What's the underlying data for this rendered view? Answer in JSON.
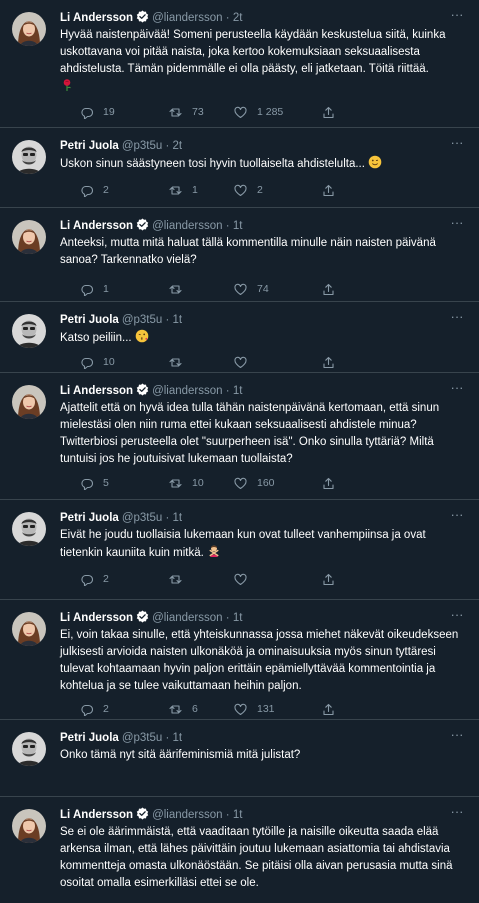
{
  "tweets": [
    {
      "author": "Li Andersson",
      "handle": "@liandersson",
      "sep": "·",
      "time": "2t",
      "verified": true,
      "avatar": "woman-avatar",
      "text": "Hyvää naistenpäivää! Someni perusteella käydään keskustelua siitä, kuinka uskottavana voi pitää naista, joka kertoo kokemuksiaan seksuaalisesta ahdistelusta. Tämän pidemmälle ei olla päästy, eli jatketaan. Töitä riittää.",
      "emoji": "rose-icon",
      "replies": "19",
      "retweets": "73",
      "likes": "1 285"
    },
    {
      "author": "Petri Juola",
      "handle": "@p3t5u",
      "sep": "·",
      "time": "2t",
      "verified": false,
      "avatar": "man-avatar",
      "text": "Uskon sinun säästyneen tosi hyvin tuollaiselta ahdistelulta...",
      "emoji": "wink-face-icon",
      "replies": "2",
      "retweets": "1",
      "likes": "2"
    },
    {
      "author": "Li Andersson",
      "handle": "@liandersson",
      "sep": "·",
      "time": "1t",
      "verified": true,
      "avatar": "woman-avatar",
      "text": "Anteeksi, mutta mitä haluat tällä kommentilla minulle näin naisten päivänä sanoa? Tarkennatko vielä?",
      "emoji": "",
      "replies": "1",
      "retweets": "",
      "likes": "74"
    },
    {
      "author": "Petri Juola",
      "handle": "@p3t5u",
      "sep": "·",
      "time": "1t",
      "verified": false,
      "avatar": "man-avatar",
      "text": "Katso peiliin...",
      "emoji": "kiss-face-icon",
      "replies": "10",
      "retweets": "",
      "likes": ""
    },
    {
      "author": "Li Andersson",
      "handle": "@liandersson",
      "sep": "·",
      "time": "1t",
      "verified": true,
      "avatar": "woman-avatar",
      "text": "Ajattelit että on hyvä idea tulla tähän naistenpäivänä kertomaan, että sinun mielestäsi olen niin ruma ettei kukaan seksuaalisesti ahdistele minua? Twitterbiosi perusteella olet \"suurperheen isä\". Onko sinulla tyttäriä? Miltä tuntuisi jos he joutuisivat lukemaan tuollaista?",
      "emoji": "",
      "replies": "5",
      "retweets": "10",
      "likes": "160"
    },
    {
      "author": "Petri Juola",
      "handle": "@p3t5u",
      "sep": "·",
      "time": "1t",
      "verified": false,
      "avatar": "man-avatar",
      "text": "Eivät he joudu tuollaisia lukemaan kun ovat tulleet vanhempiinsa ja ovat tietenkin kauniita kuin mitkä.",
      "emoji": "person-gesturing-no-icon",
      "replies": "2",
      "retweets": "",
      "likes": ""
    },
    {
      "author": "Li Andersson",
      "handle": "@liandersson",
      "sep": "·",
      "time": "1t",
      "verified": true,
      "avatar": "woman-avatar",
      "text": "Ei, voin takaa sinulle, että yhteiskunnassa jossa miehet näkevät oikeudekseen julkisesti arvioida naisten ulkonäköä ja ominaisuuksia myös sinun tyttäresi tulevat kohtaamaan hyvin paljon erittäin epämiellyttävää kommentointia ja kohtelua ja se tulee vaikuttamaan heihin paljon.",
      "emoji": "",
      "replies": "2",
      "retweets": "6",
      "likes": "131"
    },
    {
      "author": "Petri Juola",
      "handle": "@p3t5u",
      "sep": "·",
      "time": "1t",
      "verified": false,
      "avatar": "man-avatar",
      "text": "Onko tämä nyt sitä äärifeminismiä mitä julistat?",
      "emoji": "",
      "replies": "",
      "retweets": "",
      "likes": ""
    },
    {
      "author": "Li Andersson",
      "handle": "@liandersson",
      "sep": "·",
      "time": "1t",
      "verified": true,
      "avatar": "woman-avatar",
      "text": "Se ei ole äärimmäistä, että vaaditaan tytöille ja naisille oikeutta saada elää arkensa ilman, että lähes päivittäin joutuu lukemaan asiattomia tai ahdistavia kommentteja omasta ulkonäöstään. Se pitäisi olla aivan perusasia mutta sinä osoitat omalla esimerkilläsi ettei se ole.",
      "emoji": "",
      "replies": "",
      "retweets": "",
      "likes": ""
    }
  ],
  "colors": {
    "background": "#15202b",
    "text": "#ffffff",
    "muted": "#8899a6",
    "divider": "#38444d",
    "verified": "#1da1f2"
  }
}
